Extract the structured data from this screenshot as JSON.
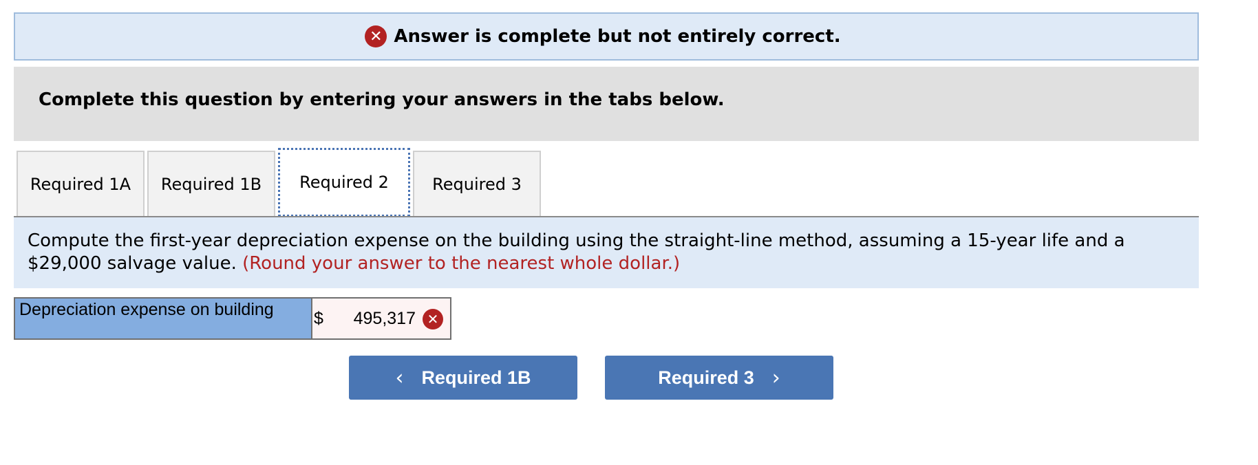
{
  "banner": {
    "status_icon": "close-icon",
    "text": "Answer is complete but not entirely correct."
  },
  "instruction": {
    "text": "Complete this question by entering your answers in the tabs below."
  },
  "tabs": [
    {
      "label": "Required 1A",
      "active": false
    },
    {
      "label": "Required 1B",
      "active": false
    },
    {
      "label": "Required 2",
      "active": true
    },
    {
      "label": "Required 3",
      "active": false
    }
  ],
  "question": {
    "text": "Compute the first-year depreciation expense on the building using the straight-line method, assuming a 15-year life and a $29,000 salvage value.",
    "hint": "(Round your answer to the nearest whole dollar.)"
  },
  "answer": {
    "label": "Depreciation expense on building",
    "currency": "$",
    "value": "495,317",
    "status": "incorrect",
    "status_icon": "close-icon"
  },
  "navigation": {
    "prev_label": "Required 1B",
    "next_label": "Required 3",
    "prev_icon": "chevron-left-icon",
    "next_icon": "chevron-right-icon"
  },
  "colors": {
    "banner_bg": "#dfeaf7",
    "error_red": "#b22222",
    "label_cell_bg": "#84ade0",
    "button_bg": "#4a76b4"
  }
}
